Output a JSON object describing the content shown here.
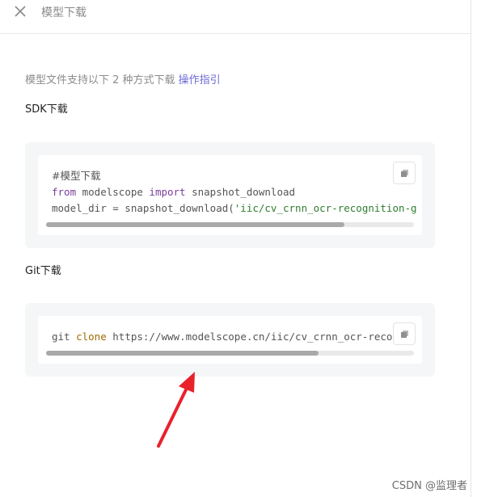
{
  "header": {
    "title": "模型下载",
    "close_icon": "close-icon"
  },
  "intro": {
    "text": "模型文件支持以下 2 种方式下载 ",
    "link": "操作指引"
  },
  "sdk": {
    "title": "SDK下载",
    "line1": "#模型下载",
    "line2_kw1": "from",
    "line2_mod": " modelscope ",
    "line2_kw2": "import",
    "line2_fn": " snapshot_download",
    "line3_pre": "model_dir = snapshot_download(",
    "line3_str": "'iic/cv_crnn_ocr-recognition-g",
    "scroll_fraction": 0.81
  },
  "git": {
    "title": "Git下载",
    "cmd_pre": "git ",
    "cmd_kw": "clone",
    "cmd_url": " https://www.modelscope.cn/iic/cv_crnn_ocr-recog",
    "scroll_fraction": 0.74
  },
  "copy_icon": "copy-icon",
  "annotation_color": "#e8212b",
  "watermark": "CSDN @监理者"
}
